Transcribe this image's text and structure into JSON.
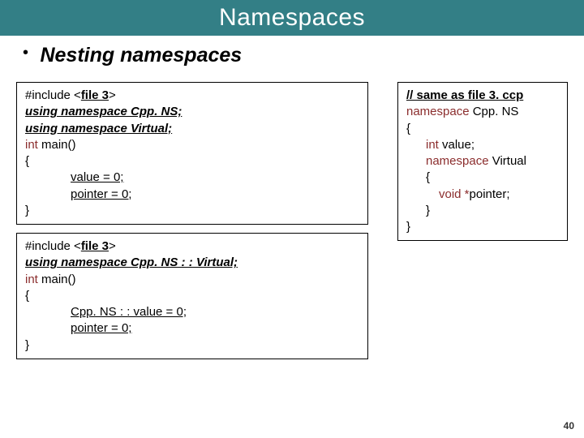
{
  "title": "Namespaces",
  "subhead": {
    "bullet": "•",
    "text": "Nesting namespaces"
  },
  "box1": {
    "l1a": "#include <",
    "l1b": "file 3",
    "l1c": ">",
    "l2": "using namespace Cpp. NS;",
    "l3": "using namespace Virtual;",
    "l4a": "int",
    "l4b": " main()",
    "l5": "{",
    "l6": "value = 0;",
    "l7": "pointer = 0;",
    "l8": "}"
  },
  "box2": {
    "l1a": "#include <",
    "l1b": "file 3",
    "l1c": ">",
    "l2": "using namespace Cpp. NS : : Virtual;",
    "l3a": "int",
    "l3b": " main()",
    "l4": "{",
    "l5": "Cpp. NS : : value = 0;",
    "l6": "pointer = 0;",
    "l7": "}"
  },
  "box3": {
    "l1a": "// same as ",
    "l1b": "file 3. ccp",
    "l2a": "namespace ",
    "l2b": "Cpp. NS",
    "l3": "{",
    "l4a": "int",
    "l4b": " value;",
    "l5a": "namespace ",
    "l5b": "Virtual",
    "l6": "{",
    "l7a": "void *",
    "l7b": "pointer;",
    "l8": "}",
    "l9": "}"
  },
  "page": "40"
}
